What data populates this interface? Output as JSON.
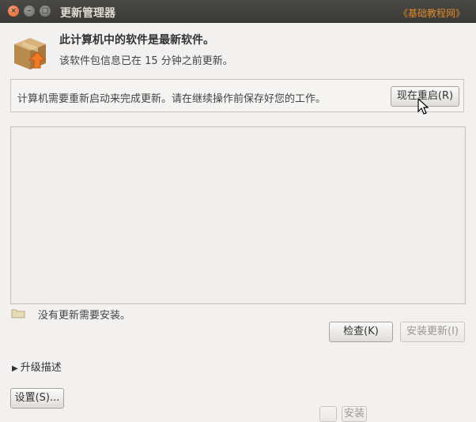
{
  "window": {
    "title": "更新管理器",
    "watermark": "《基础教程网》",
    "controls": {
      "close": "×",
      "minimize": "–",
      "maximize": "□"
    }
  },
  "header": {
    "heading": "此计算机中的软件是最新软件。",
    "subheading": "该软件包信息已在 15 分钟之前更新。",
    "icon": "package-box-icon"
  },
  "restart_notice": {
    "message": "计算机需要重新启动来完成更新。请在继续操作前保存好您的工作。",
    "button_label": "现在重启(R)"
  },
  "updates_list": {
    "items": []
  },
  "status": {
    "text": "没有更新需要安装。",
    "icon": "folder-icon"
  },
  "actions": {
    "check_label": "检查(K)",
    "install_label": "安装更新(I)"
  },
  "expander": {
    "label": "升级描述",
    "arrow": "▶"
  },
  "footer": {
    "settings_label": "设置(S)...",
    "cut_button_label": "安装"
  },
  "colors": {
    "titlebar": "#3c3b37",
    "background": "#f2f1f0",
    "close_button": "#e05a22",
    "watermark": "#e08a2a"
  }
}
